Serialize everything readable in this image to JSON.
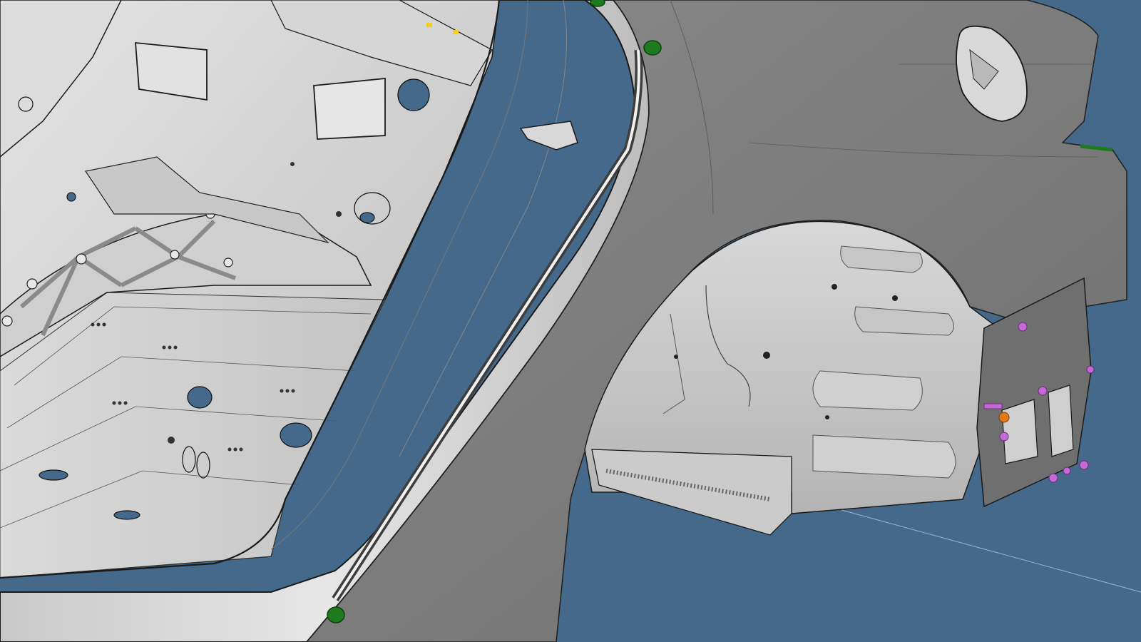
{
  "viewport": {
    "background_color": "#44698a",
    "body_panel_color": "#7f7f7f",
    "interior_panel_color": "#d3d3d3",
    "edge_line_color": "#1a1a1a",
    "clip_color_green": "#1e7a1e",
    "clip_color_magenta": "#c46ad6",
    "clip_color_orange": "#e07a1a"
  }
}
